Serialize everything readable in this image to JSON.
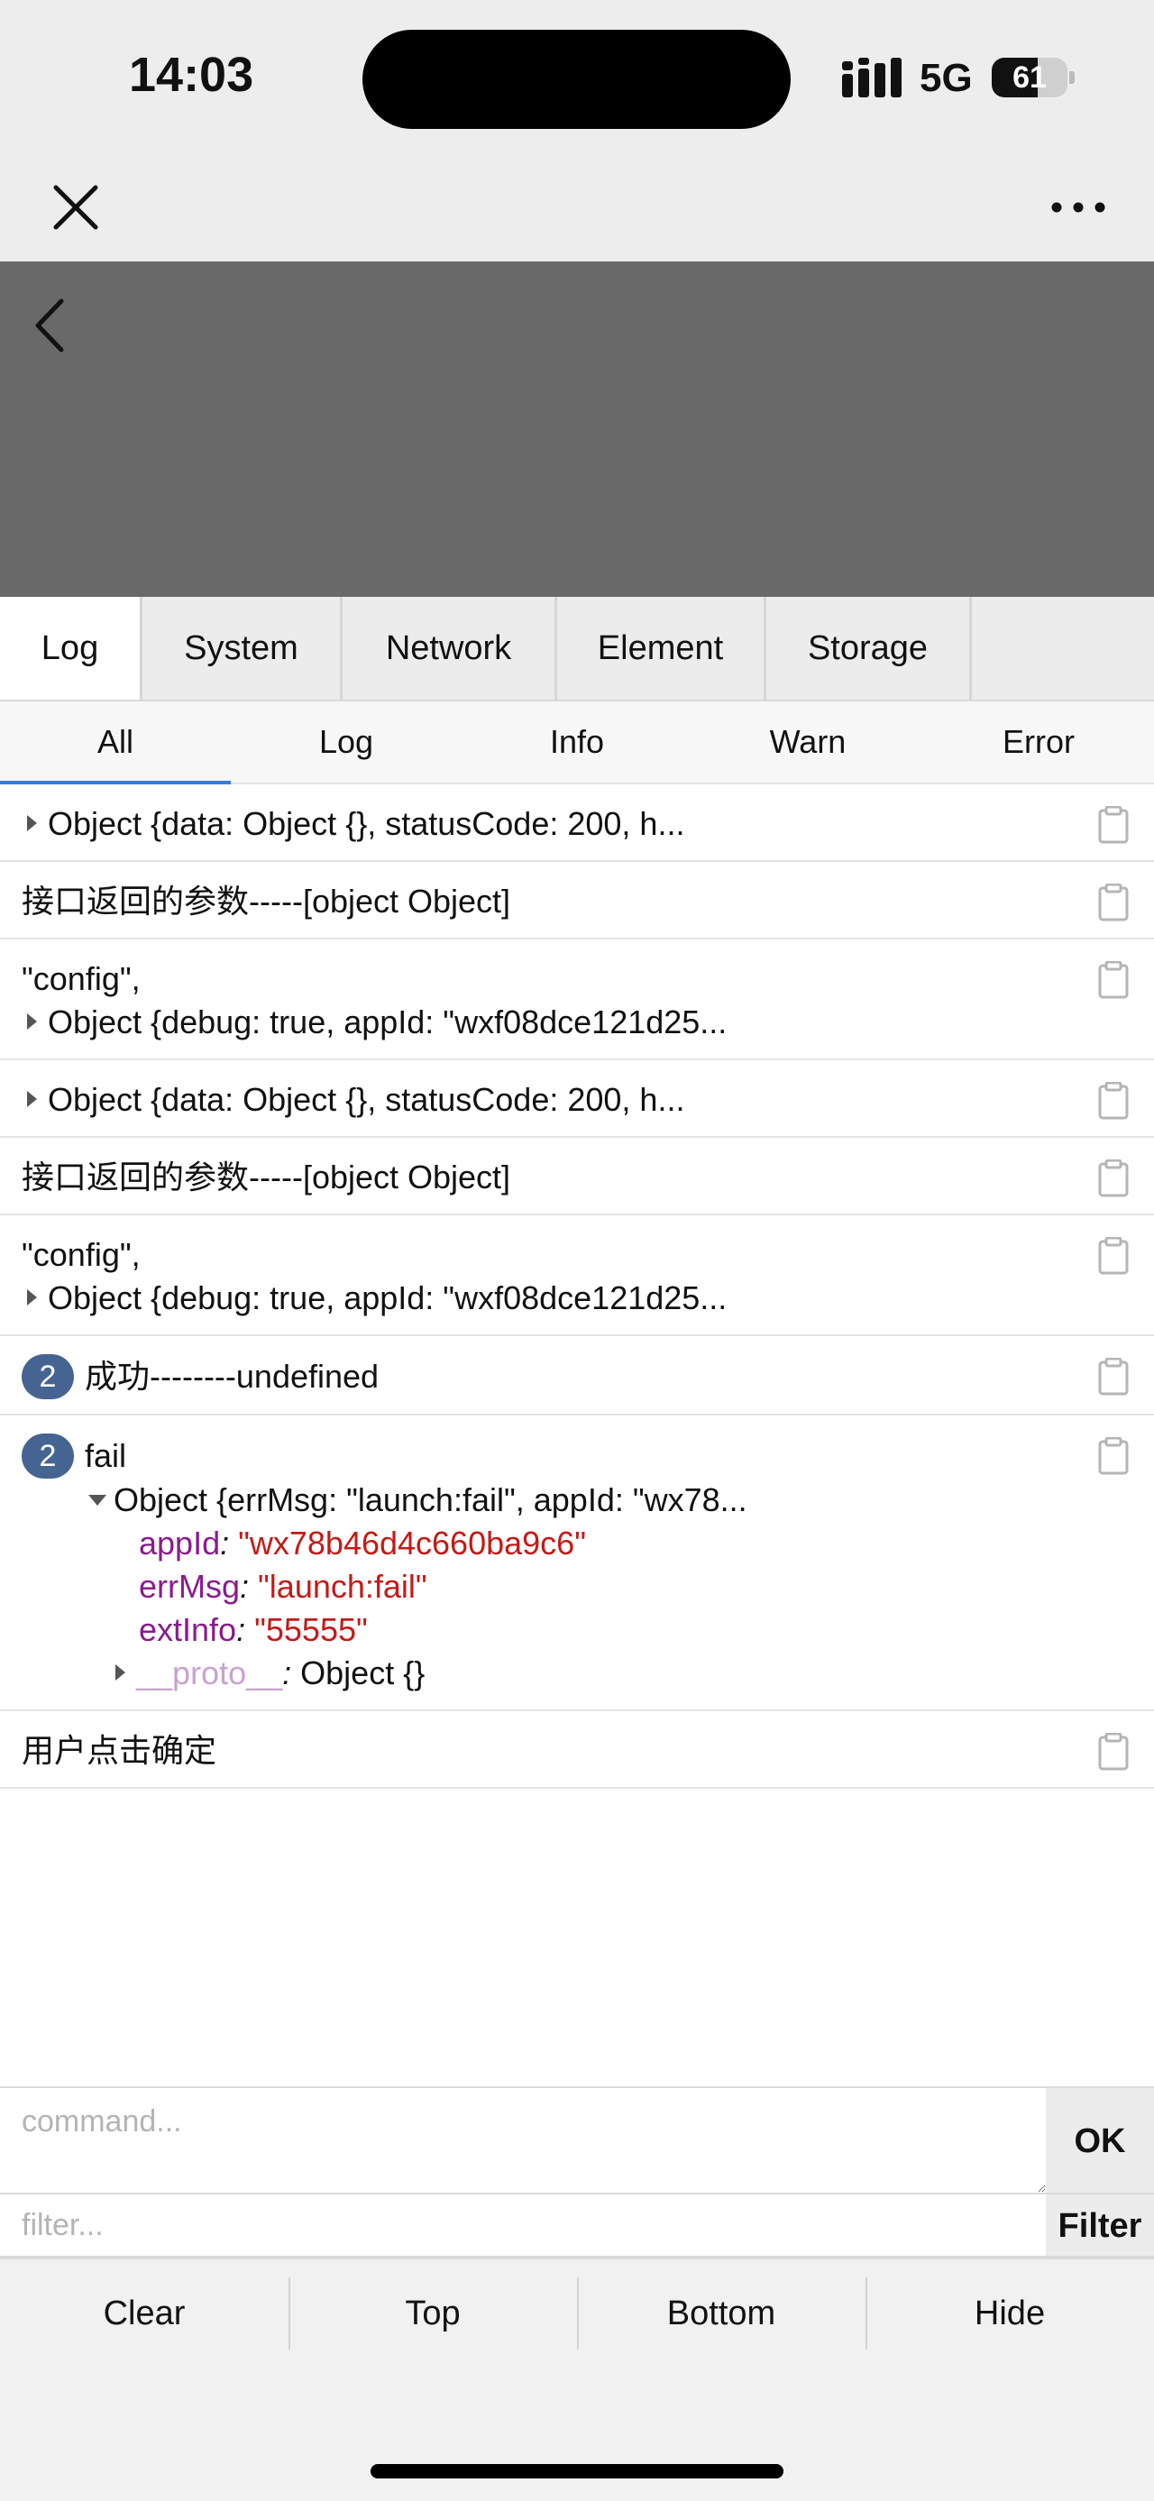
{
  "status_bar": {
    "time": "14:03",
    "network": "5G",
    "battery": "61",
    "battery_fraction": 0.61
  },
  "nav": {
    "close_icon": "close-icon",
    "more_icon": "more-dots-icon"
  },
  "page": {
    "back_icon": "chevron-left-icon",
    "header_color": "#696969"
  },
  "main_tabs": [
    "Log",
    "System",
    "Network",
    "Element",
    "Storage"
  ],
  "sub_tabs": [
    "All",
    "Log",
    "Info",
    "Warn",
    "Error"
  ],
  "accent_color": "#3a7bd5",
  "logs": [
    {
      "lines": [
        "Object {data: Object {}, statusCode: 200, h..."
      ]
    },
    {
      "lines": [
        "接口返回的参数-----[object Object]"
      ]
    },
    {
      "lines": [
        "\"config\",",
        "Object {debug: true, appId: \"wxf08dce121d25..."
      ]
    },
    {
      "lines": [
        "Object {data: Object {}, statusCode: 200, h..."
      ]
    },
    {
      "lines": [
        "接口返回的参数-----[object Object]"
      ]
    },
    {
      "lines": [
        "\"config\",",
        "Object {debug: true, appId: \"wxf08dce121d25..."
      ]
    },
    {
      "badge": "2",
      "lines": [
        "成功--------undefined"
      ]
    },
    {
      "badge": "2",
      "title": "fail",
      "object": "Object {errMsg: \"launch:fail\", appId: \"wx78...",
      "props": [
        {
          "key": "appId",
          "value": "\"wx78b46d4c660ba9c6\""
        },
        {
          "key": "errMsg",
          "value": "\"launch:fail\""
        },
        {
          "key": "extInfo",
          "value": "\"55555\""
        }
      ],
      "proto_key": "__proto__",
      "proto_value": "Object {}"
    },
    {
      "lines": [
        "用户点击确定"
      ]
    }
  ],
  "command": {
    "placeholder": "command...",
    "ok_label": "OK",
    "filter_placeholder": "filter...",
    "filter_label": "Filter"
  },
  "toolbar": [
    "Clear",
    "Top",
    "Bottom",
    "Hide"
  ]
}
